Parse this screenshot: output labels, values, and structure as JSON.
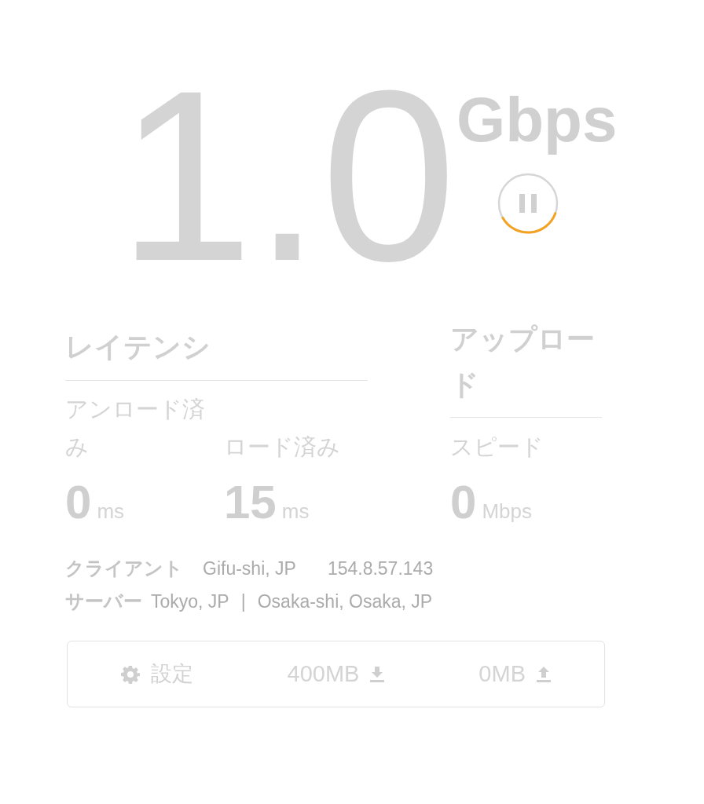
{
  "speed": {
    "value": "1.0",
    "unit": "Gbps"
  },
  "latency": {
    "title": "レイテンシ",
    "metrics": [
      {
        "label": "アンロード済み",
        "value": "0",
        "unit": "ms"
      },
      {
        "label": "ロード済み",
        "value": "15",
        "unit": "ms"
      }
    ]
  },
  "upload": {
    "title": "アップロード",
    "metrics": [
      {
        "label": "スピード",
        "value": "0",
        "unit": "Mbps"
      }
    ]
  },
  "connection": {
    "client": {
      "label": "クライアント",
      "location": "Gifu-shi, JP",
      "ip": "154.8.57.143"
    },
    "server": {
      "label": "サーバー",
      "locations": [
        "Tokyo, JP",
        "Osaka-shi, Osaka, JP"
      ],
      "separator": "|"
    }
  },
  "settings_bar": {
    "items": [
      {
        "kind": "settings",
        "label": "設定"
      },
      {
        "kind": "download",
        "label": "400MB"
      },
      {
        "kind": "upload",
        "label": "0MB"
      }
    ]
  }
}
